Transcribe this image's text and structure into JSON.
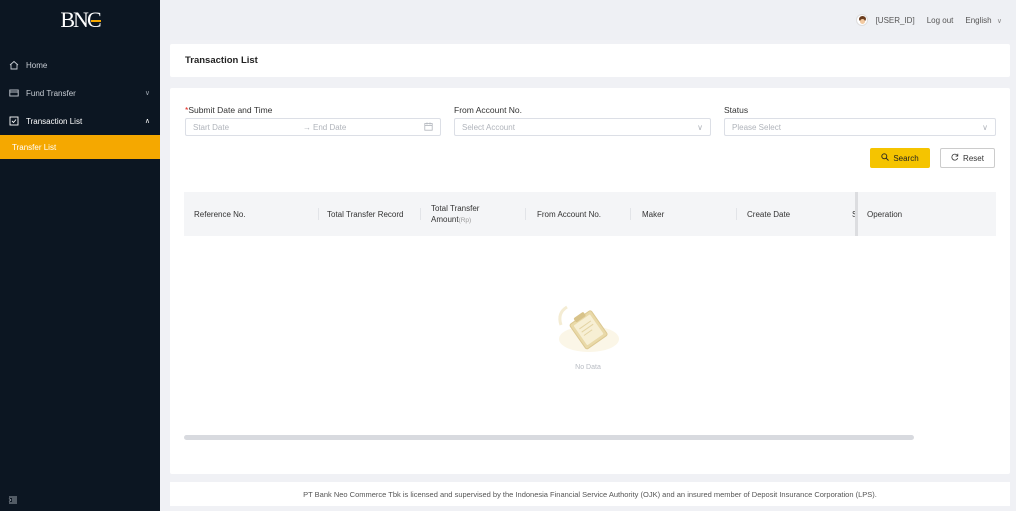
{
  "brand": {
    "logo_text": "BNC",
    "accent": "#f5a800"
  },
  "sidebar": {
    "items": [
      {
        "label": "Home",
        "icon": "home-icon"
      },
      {
        "label": "Fund Transfer",
        "icon": "card-icon"
      },
      {
        "label": "Transaction List",
        "icon": "checklist-icon"
      }
    ],
    "active_sub": "Transfer List"
  },
  "topbar": {
    "user": "[USER_ID]",
    "logout": "Log out",
    "language": "English"
  },
  "page": {
    "title": "Transaction List"
  },
  "filters": {
    "submit_label": "Submit Date and Time",
    "start_placeholder": "Start Date",
    "end_placeholder": "End Date",
    "account_label": "From Account No.",
    "account_placeholder": "Select Account",
    "status_label": "Status",
    "status_placeholder": "Please Select"
  },
  "buttons": {
    "search": "Search",
    "reset": "Reset"
  },
  "table": {
    "columns": [
      "Reference No.",
      "Total Transfer Record",
      "Total Transfer",
      "Amount",
      "(Rp)",
      "From Account No.",
      "Maker",
      "Create Date",
      "S",
      "Operation"
    ],
    "empty_text": "No Data"
  },
  "footer": {
    "text": "PT Bank Neo Commerce Tbk is licensed and supervised by the Indonesia Financial Service Authority (OJK) and an insured member of Deposit Insurance Corporation (LPS)."
  }
}
